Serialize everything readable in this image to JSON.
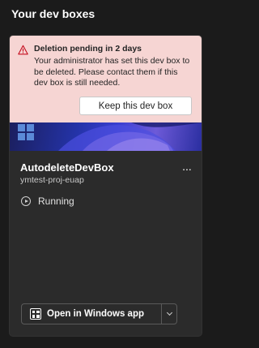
{
  "page": {
    "title": "Your dev boxes"
  },
  "warning": {
    "title": "Deletion pending in 2 days",
    "message": "Your administrator has set this dev box to be deleted. Please contact them if this dev box is still needed.",
    "keep_label": "Keep this dev box",
    "icon": "warning-icon",
    "background": "#f6d5d3"
  },
  "devbox": {
    "name": "AutodeleteDevBox",
    "project": "ymtest-proj-euap",
    "more_label": "...",
    "status": "Running",
    "status_icon": "play-circle-icon"
  },
  "actions": {
    "open_label": "Open in Windows app",
    "open_icon": "windows-app-icon",
    "dropdown_icon": "chevron-down-icon"
  },
  "colors": {
    "background": "#1b1b1b",
    "card": "#2b2b2b",
    "warning_icon": "#c50f1f"
  }
}
